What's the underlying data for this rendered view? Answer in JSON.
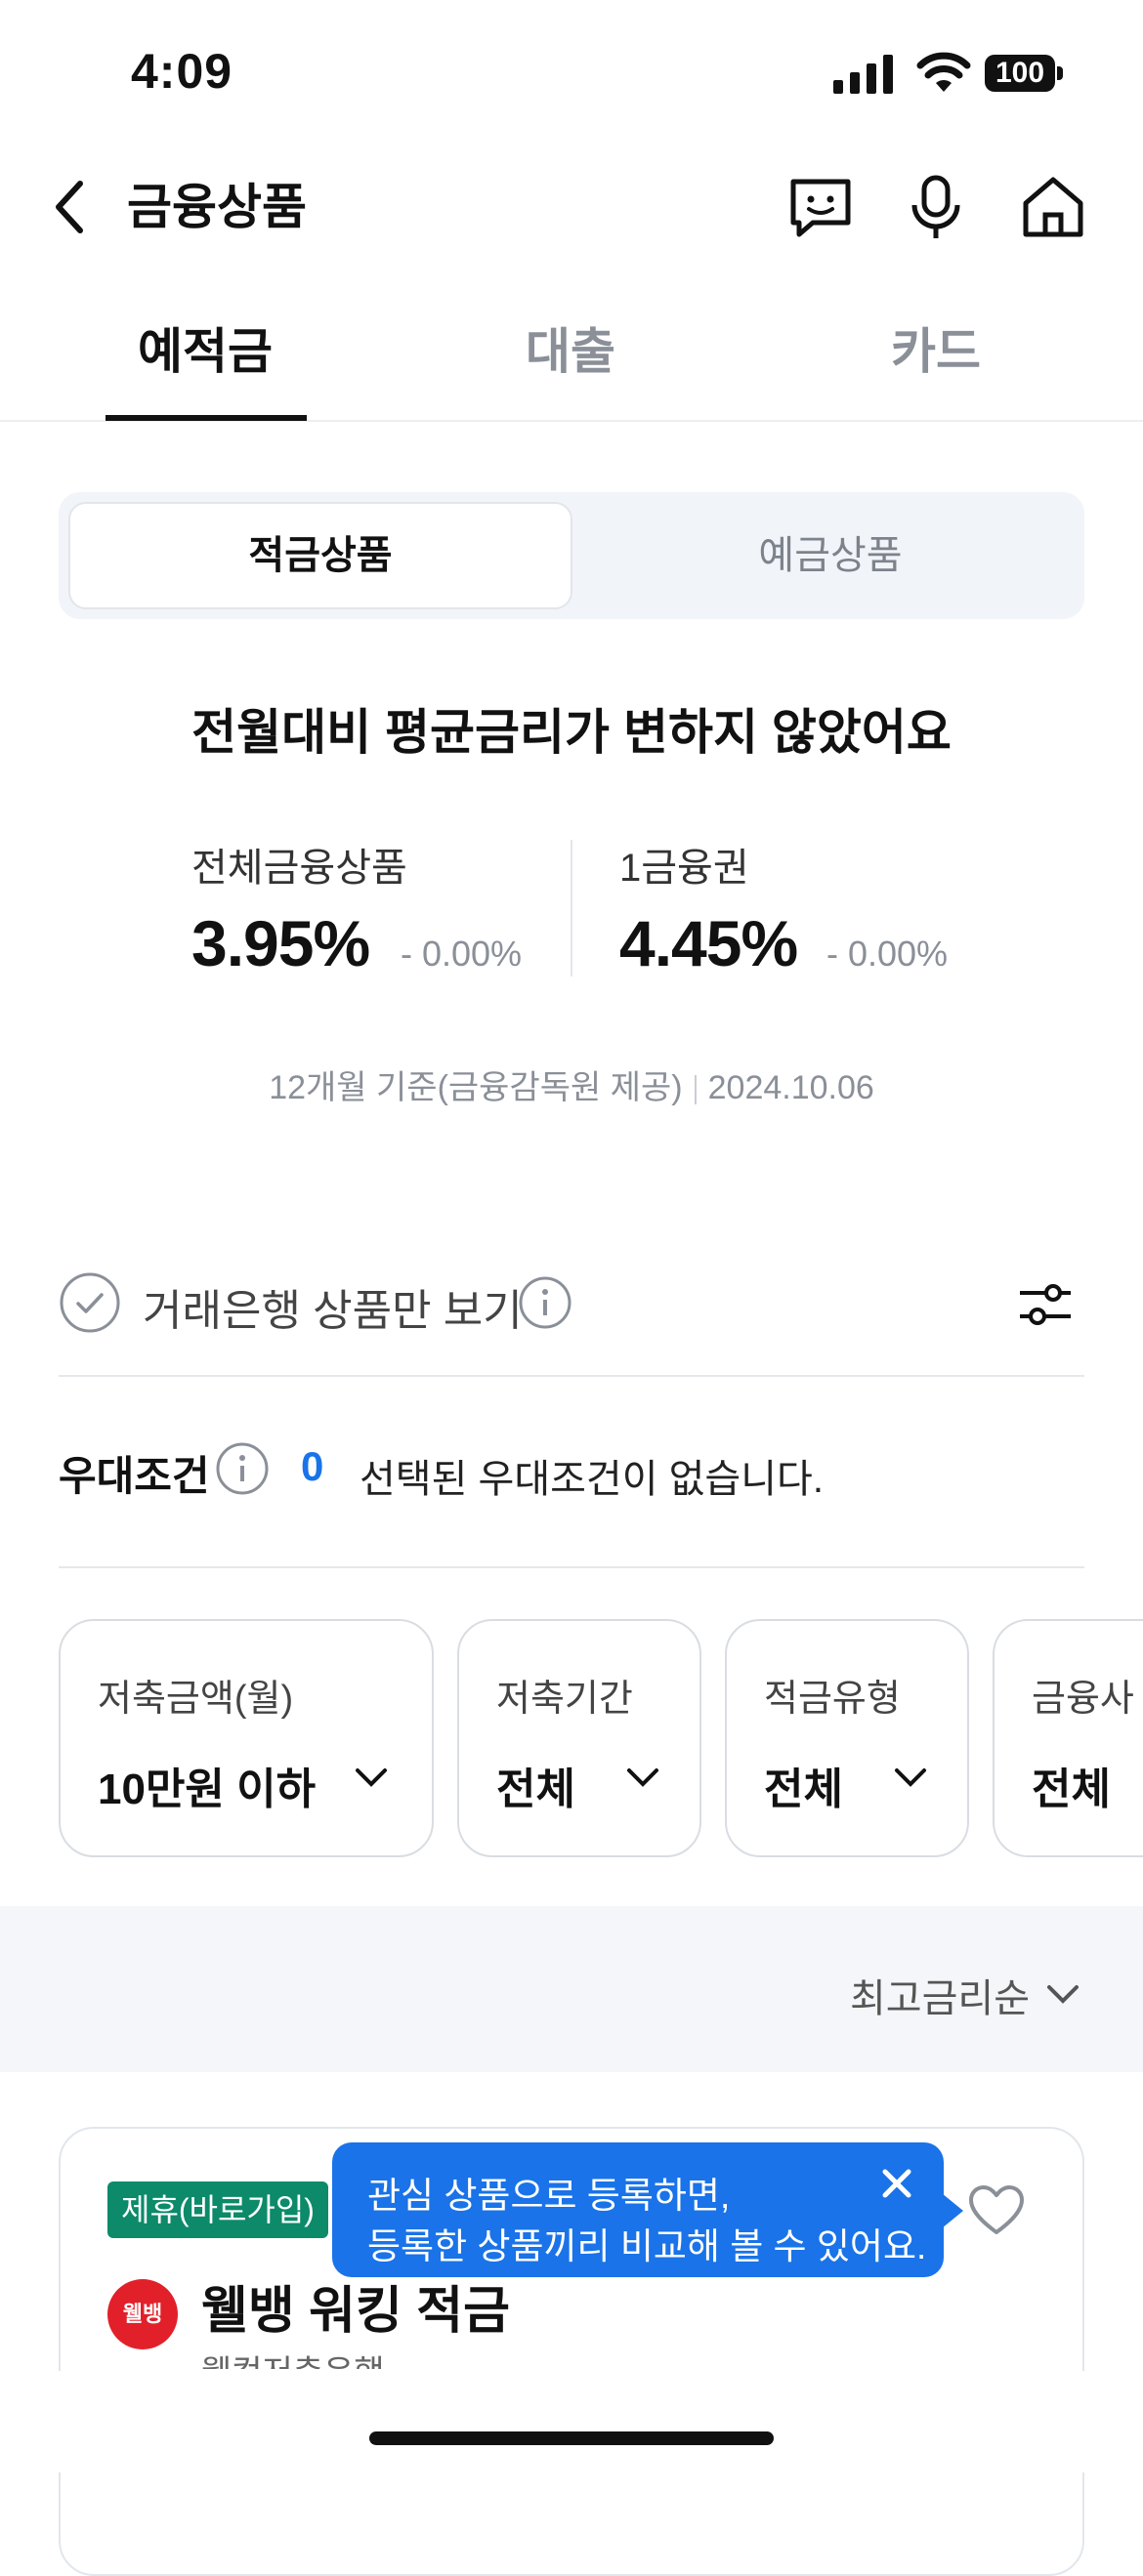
{
  "status": {
    "time": "4:09",
    "battery": "100"
  },
  "header": {
    "title": "금융상품",
    "icons": [
      "chat-bot-icon",
      "microphone-icon",
      "home-icon"
    ]
  },
  "tabs": [
    {
      "label": "예적금",
      "active": true
    },
    {
      "label": "대출"
    },
    {
      "label": "카드"
    }
  ],
  "segment": {
    "active": "적금상품",
    "inactive": "예금상품"
  },
  "summary": {
    "headline": "전월대비 평균금리가 변하지 않았어요",
    "all": {
      "label": "전체금융상품",
      "rate": "3.95%",
      "diff": "- 0.00%"
    },
    "tier1": {
      "label": "1금융권",
      "rate": "4.45%",
      "diff": "- 0.00%"
    },
    "basis": "12개월 기준(금융감독원 제공)",
    "date": "2024.10.06"
  },
  "filter": {
    "only_bank": "거래은행 상품만 보기",
    "condition_label": "우대조건",
    "condition_count": "0",
    "condition_text": "선택된 우대조건이 없습니다."
  },
  "chips": [
    {
      "label": "저축금액(월)",
      "value": "10만원 이하"
    },
    {
      "label": "저축기간",
      "value": "전체"
    },
    {
      "label": "적금유형",
      "value": "전체"
    },
    {
      "label": "금융사",
      "value": "전체"
    }
  ],
  "sort": {
    "label": "최고금리순"
  },
  "product": {
    "badge": "제휴(바로가입)",
    "logo_text": "웰뱅",
    "name": "웰뱅 워킹 적금",
    "bank": "웰컴저축은행"
  },
  "tooltip": {
    "line1": "관심 상품으로 등록하면,",
    "line2": "등록한 상품끼리 비교해 볼 수 있어요."
  },
  "colors": {
    "accent": "#1a73e8",
    "badge": "#0c8a6a",
    "logo": "#e2202a"
  }
}
